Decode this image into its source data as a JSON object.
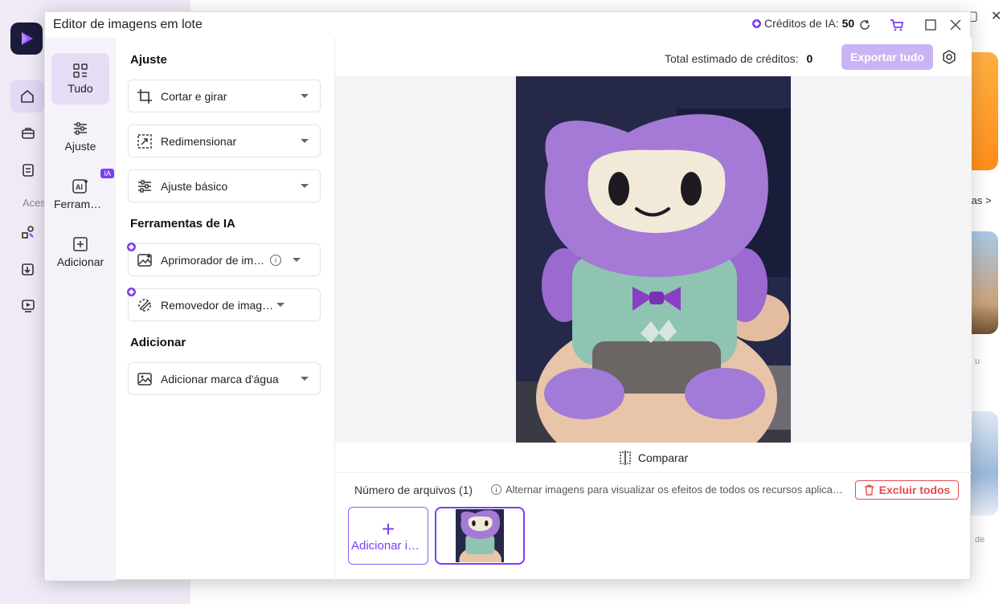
{
  "dialog": {
    "title": "Editor de imagens em lote",
    "credits_label": "Créditos de IA:",
    "credits_value": "50"
  },
  "tabs": [
    {
      "label": "Tudo",
      "icon": "grid-icon",
      "selected": true
    },
    {
      "label": "Ajuste",
      "icon": "sliders-icon"
    },
    {
      "label": "Ferramentas de IA",
      "icon": "ai-icon",
      "badge": "IA"
    },
    {
      "label": "Adicionar",
      "icon": "add-square-icon"
    }
  ],
  "sections": {
    "ajuste": "Ajuste",
    "ai": "Ferramentas de IA",
    "adicionar": "Adicionar"
  },
  "tools": [
    {
      "label": "Cortar e girar",
      "icon": "crop-rotate-icon"
    },
    {
      "label": "Redimensionar",
      "icon": "resize-icon"
    },
    {
      "label": "Ajuste básico",
      "icon": "sliders-icon"
    },
    {
      "label": "Aprimorador de imagem",
      "icon": "image-enhance-icon",
      "ai": true,
      "info": true
    },
    {
      "label": "Removedor de imagem",
      "icon": "background-remove-icon",
      "ai": true
    },
    {
      "label": "Adicionar marca d'água",
      "icon": "watermark-icon"
    }
  ],
  "topbar": {
    "estimate_label": "Total estimado de créditos:",
    "estimate_value": "0",
    "export_label": "Exportar tudo"
  },
  "preview": {
    "compare_label": "Comparar"
  },
  "files": {
    "count_label": "Número de arquivos (1)",
    "hint": "Alternar imagens para visualizar os efeitos de todos os recursos aplicados",
    "delete_label": "Excluir todos",
    "add_label": "Adicionar imagens"
  },
  "background": {
    "rail_text": "Aces",
    "link_text": "tas >",
    "small_text_1": "u",
    "small_text_2": "de"
  },
  "colors": {
    "accent": "#7b3ff2",
    "accent_light": "#c9b5f3",
    "danger": "#e54b4b"
  }
}
